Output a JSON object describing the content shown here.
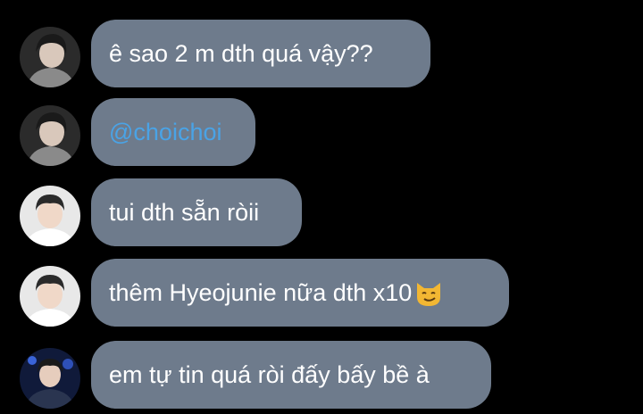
{
  "colors": {
    "background": "#000000",
    "bubble": "#6e7b8c",
    "text": "#ffffff",
    "mention": "#4aa3e6"
  },
  "messages": [
    {
      "text": "ê sao 2 m dth quá vậy??",
      "avatar": "avatar-user-1"
    },
    {
      "text": "@choichoi",
      "avatar": "avatar-user-1",
      "is_mention": true
    },
    {
      "text": "tui dth sẵn ròii",
      "avatar": "avatar-user-2"
    },
    {
      "text": "thêm Hyeojunie nữa dth x10",
      "emoji": "smirking-cat-emoji",
      "avatar": "avatar-user-2"
    },
    {
      "text": "em tự tin quá ròi đấy bấy bề à",
      "avatar": "avatar-user-3"
    }
  ]
}
